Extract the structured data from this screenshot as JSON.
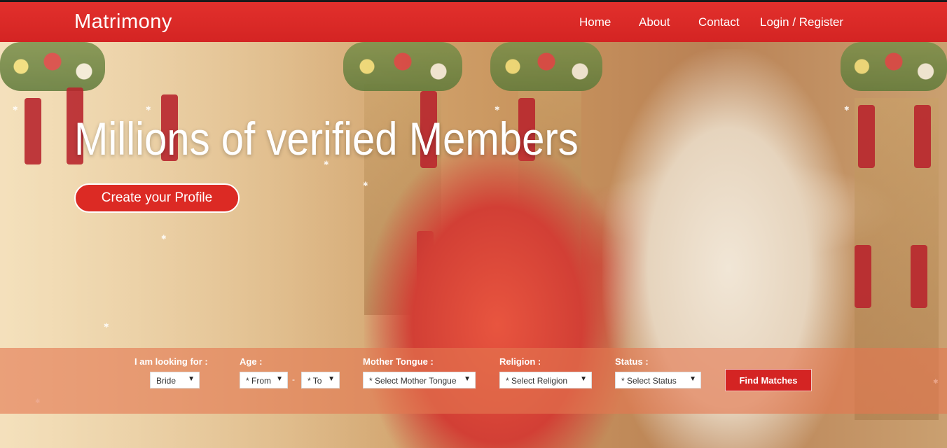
{
  "brand": "Matrimony",
  "nav": {
    "home": "Home",
    "about": "About",
    "contact": "Contact",
    "login": "Login / Register"
  },
  "hero": {
    "headline": "Millions of verified Members",
    "cta": "Create your Profile"
  },
  "search": {
    "looking_for_label": "I am looking for :",
    "looking_for_value": "Bride",
    "age_label": "Age :",
    "age_from": "* From",
    "age_separator": "-",
    "age_to": "* To",
    "mother_tongue_label": "Mother Tongue :",
    "mother_tongue_value": "* Select Mother Tongue",
    "religion_label": "Religion :",
    "religion_value": "* Select Religion",
    "status_label": "Status :",
    "status_value": "* Select Status",
    "find_button": "Find Matches"
  },
  "colors": {
    "accent": "#d42423",
    "search_bar": "#e47850"
  }
}
